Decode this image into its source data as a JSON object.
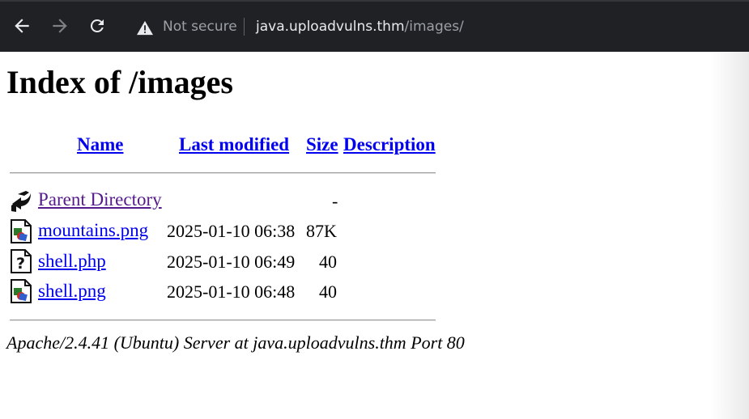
{
  "browser": {
    "security_label": "Not secure",
    "url_host": "java.uploadvulns.thm",
    "url_path": "/images/",
    "icons": {
      "back": "back-arrow-icon",
      "forward": "forward-arrow-icon",
      "reload": "reload-icon",
      "security": "warning-triangle-icon"
    }
  },
  "page": {
    "title": "Index of /images",
    "columns": {
      "name": "Name",
      "last_modified": "Last modified",
      "size": "Size",
      "description": "Description"
    },
    "rows": [
      {
        "icon": "back-folder-icon",
        "name": "Parent Directory",
        "modified": "",
        "size": "-",
        "visited": true
      },
      {
        "icon": "image-file-icon",
        "name": "mountains.png",
        "modified": "2025-01-10 06:38",
        "size": "87K",
        "visited": false
      },
      {
        "icon": "unknown-file-icon",
        "name": "shell.php",
        "modified": "2025-01-10 06:49",
        "size": "40",
        "visited": false
      },
      {
        "icon": "image-file-icon",
        "name": "shell.png",
        "modified": "2025-01-10 06:48",
        "size": "40",
        "visited": false
      }
    ],
    "footer": "Apache/2.4.41 (Ubuntu) Server at java.uploadvulns.thm Port 80"
  },
  "colors": {
    "link": "#0000ee",
    "visited": "#551a8b",
    "toolbar": "#202124"
  }
}
